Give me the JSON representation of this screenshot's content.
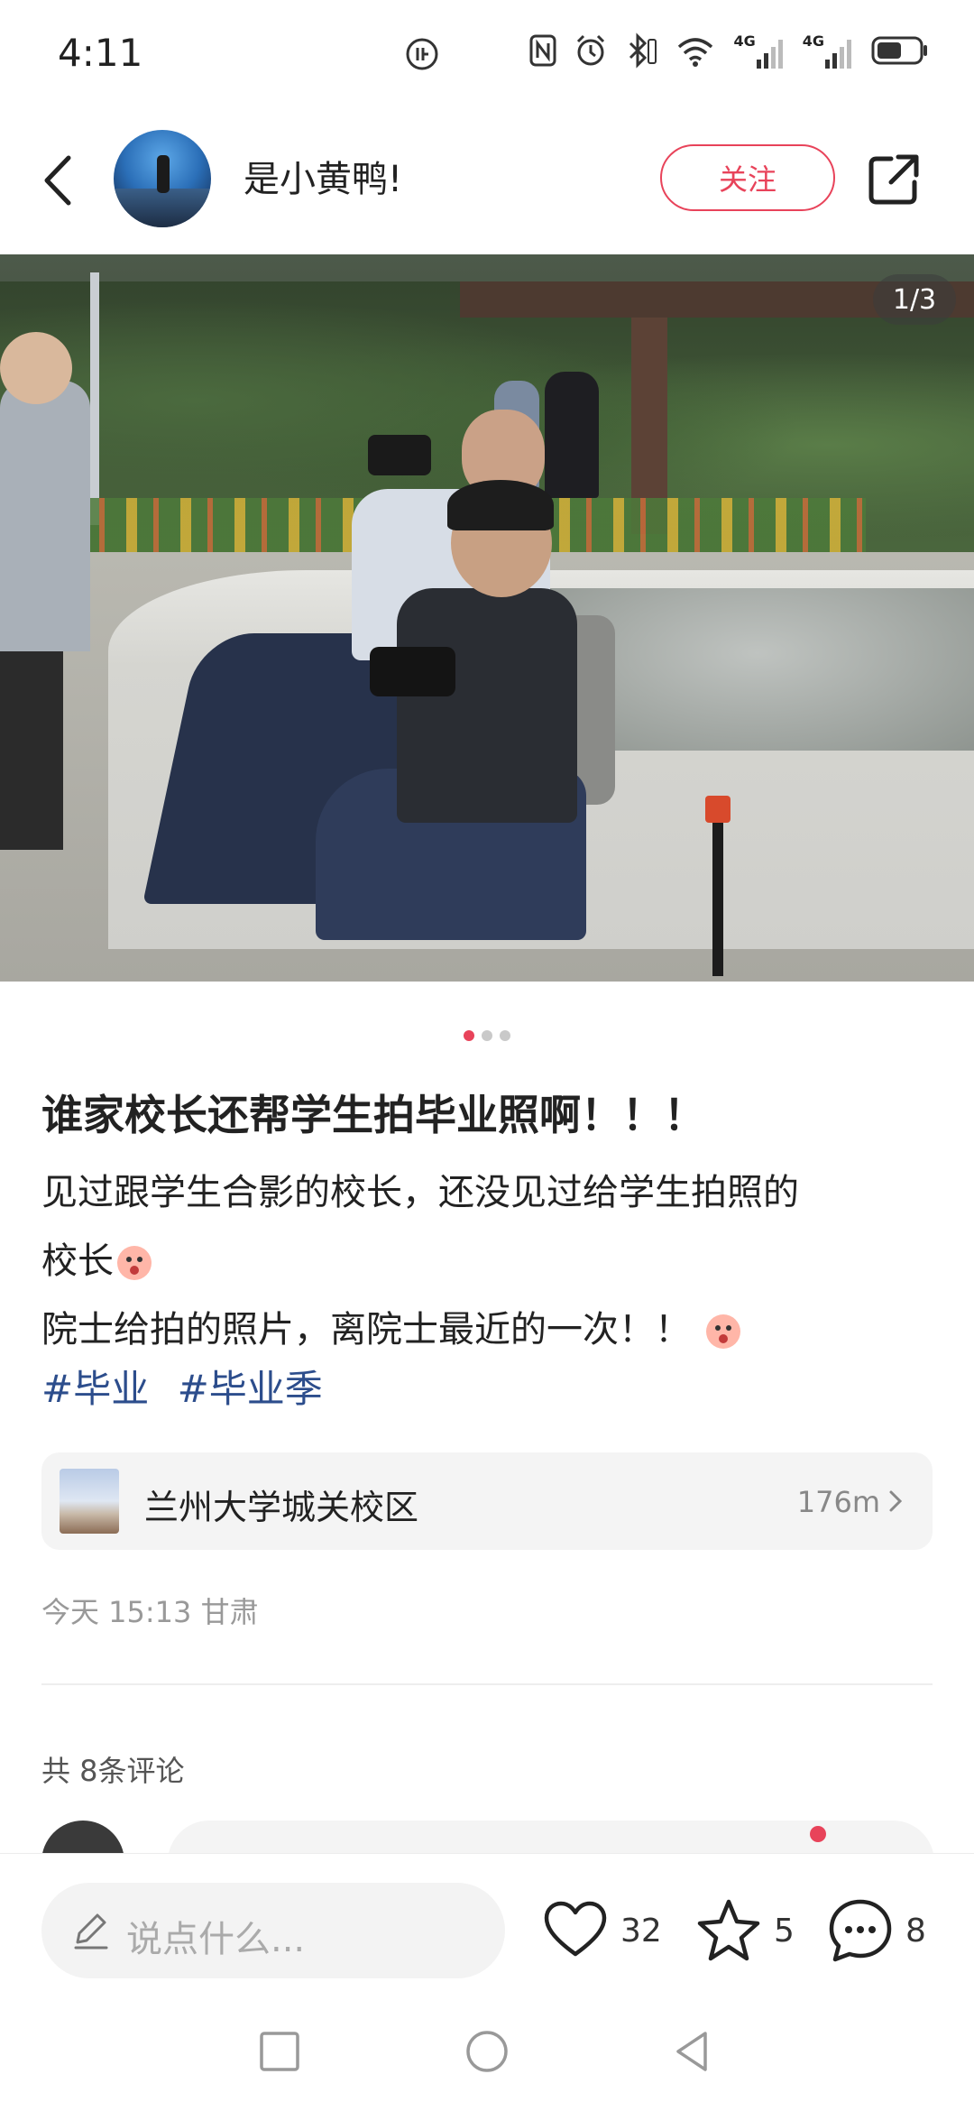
{
  "status_bar": {
    "time": "4:11",
    "icons": [
      "app-badge-icon",
      "nfc-icon",
      "alarm-icon",
      "bluetooth-icon",
      "wifi-icon",
      "signal-4g-icon",
      "signal-4g-icon",
      "battery-icon"
    ],
    "signal_1_label": "4G",
    "signal_2_label": "4G"
  },
  "header": {
    "username": "是小黄鸭!",
    "follow_label": "关注"
  },
  "carousel": {
    "counter": "1/3",
    "total": 3,
    "active_index": 0
  },
  "post": {
    "title": "谁家校长还帮学生拍毕业照啊！！！",
    "body_lines": [
      "见过跟学生合影的校长，还没见过给学生拍照的",
      "校长",
      "院士给拍的照片，离院士最近的一次！！"
    ],
    "tags": [
      "#毕业",
      "#毕业季"
    ]
  },
  "location": {
    "name": "兰州大学城关校区",
    "distance": "176m"
  },
  "meta": {
    "date_region": "今天 15:13 甘肃"
  },
  "comments": {
    "count_label": "共 8条评论"
  },
  "bottom_bar": {
    "input_placeholder": "说点什么...",
    "like_count": "32",
    "collect_count": "5",
    "comment_count": "8"
  },
  "colors": {
    "accent": "#e8435a",
    "tag": "#2c4d8c"
  }
}
